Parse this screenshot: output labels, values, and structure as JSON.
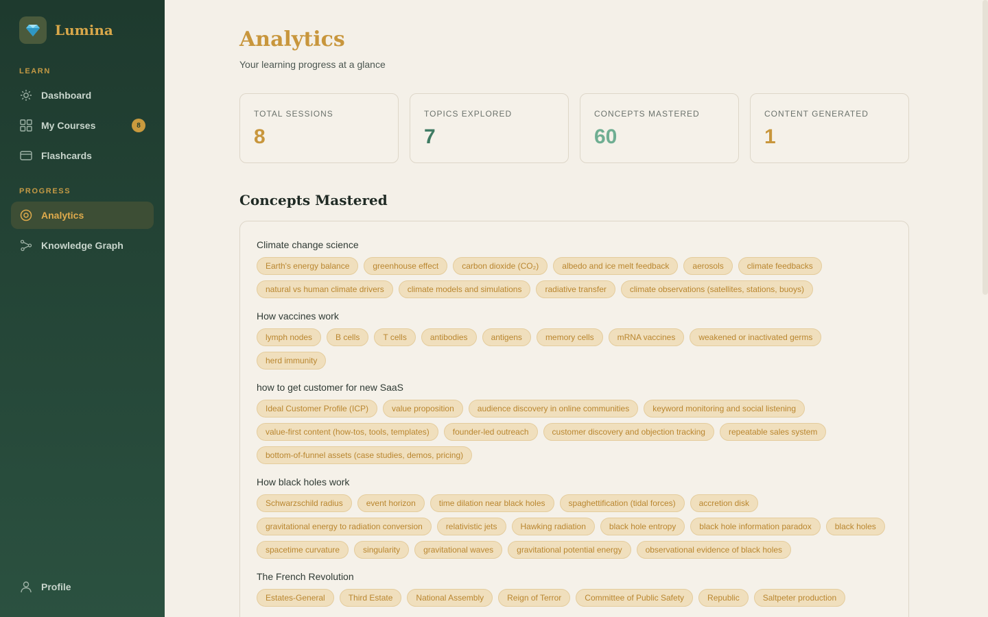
{
  "app": {
    "name": "Lumina"
  },
  "sidebar": {
    "learn_label": "LEARN",
    "progress_label": "PROGRESS",
    "items": [
      {
        "label": "Dashboard",
        "icon": "sun-icon"
      },
      {
        "label": "My Courses",
        "icon": "grid-icon",
        "badge": "8"
      },
      {
        "label": "Flashcards",
        "icon": "card-icon"
      },
      {
        "label": "Analytics",
        "icon": "target-icon",
        "active": true
      },
      {
        "label": "Knowledge Graph",
        "icon": "graph-icon"
      }
    ],
    "profile_label": "Profile"
  },
  "header": {
    "title": "Analytics",
    "subtitle": "Your learning progress at a glance"
  },
  "stats": [
    {
      "label": "TOTAL SESSIONS",
      "value": "8",
      "color": "#c8963c"
    },
    {
      "label": "TOPICS EXPLORED",
      "value": "7",
      "color": "#3f7b63"
    },
    {
      "label": "CONCEPTS MASTERED",
      "value": "60",
      "color": "#6fae92"
    },
    {
      "label": "CONTENT GENERATED",
      "value": "1",
      "color": "#c8963c"
    }
  ],
  "concepts": {
    "title": "Concepts Mastered",
    "groups": [
      {
        "title": "Climate change science",
        "tags": [
          "Earth's energy balance",
          "greenhouse effect",
          "carbon dioxide (CO₂)",
          "albedo and ice melt feedback",
          "aerosols",
          "climate feedbacks",
          "natural vs human climate drivers",
          "climate models and simulations",
          "radiative transfer",
          "climate observations (satellites, stations, buoys)"
        ]
      },
      {
        "title": "How vaccines work",
        "tags": [
          "lymph nodes",
          "B cells",
          "T cells",
          "antibodies",
          "antigens",
          "memory cells",
          "mRNA vaccines",
          "weakened or inactivated germs",
          "herd immunity"
        ]
      },
      {
        "title": "how to get customer for new SaaS",
        "tags": [
          "Ideal Customer Profile (ICP)",
          "value proposition",
          "audience discovery in online communities",
          "keyword monitoring and social listening",
          "value-first content (how-tos, tools, templates)",
          "founder-led outreach",
          "customer discovery and objection tracking",
          "repeatable sales system",
          "bottom-of-funnel assets (case studies, demos, pricing)"
        ]
      },
      {
        "title": "How black holes work",
        "tags": [
          "Schwarzschild radius",
          "event horizon",
          "time dilation near black holes",
          "spaghettification (tidal forces)",
          "accretion disk",
          "gravitational energy to radiation conversion",
          "relativistic jets",
          "Hawking radiation",
          "black hole entropy",
          "black hole information paradox",
          "black holes",
          "spacetime curvature",
          "singularity",
          "gravitational waves",
          "gravitational potential energy",
          "observational evidence of black holes"
        ]
      },
      {
        "title": "The French Revolution",
        "tags": [
          "Estates-General",
          "Third Estate",
          "National Assembly",
          "Reign of Terror",
          "Committee of Public Safety",
          "Republic",
          "Saltpeter production"
        ]
      }
    ]
  }
}
